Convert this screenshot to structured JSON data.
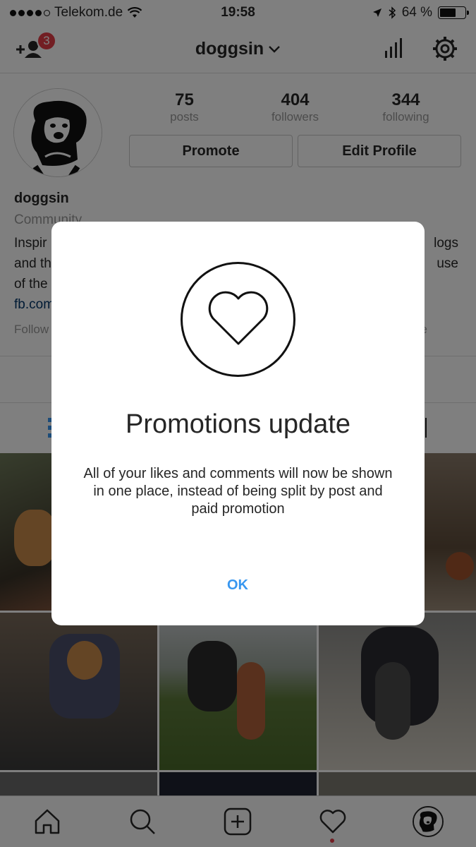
{
  "status_bar": {
    "carrier": "Telekom.de",
    "time": "19:58",
    "battery": "64 %",
    "battery_level": 0.64
  },
  "nav": {
    "username": "doggsin",
    "notification_count": "3"
  },
  "profile": {
    "stats": [
      {
        "value": "75",
        "label": "posts"
      },
      {
        "value": "404",
        "label": "followers"
      },
      {
        "value": "344",
        "label": "following"
      }
    ],
    "promote_label": "Promote",
    "edit_label": "Edit Profile",
    "name": "doggsin",
    "category": "Community",
    "bio_line1": "Inspir",
    "bio_line1_end": "logs",
    "bio_line2": "and th",
    "bio_line2_end": "use",
    "bio_line3": "of the",
    "link": "fb.com",
    "followed_by": "Follow",
    "followed_by_end": "e"
  },
  "modal": {
    "icon": "heart-icon",
    "title": "Promotions update",
    "body": "All of your likes and comments will now be shown in one place, instead of being split by post and paid promotion",
    "ok_label": "OK"
  },
  "tabbar": {
    "items": [
      "home-icon",
      "search-icon",
      "add-post-icon",
      "activity-heart-icon",
      "profile-avatar"
    ]
  },
  "colors": {
    "accent_blue": "#3897f0",
    "badge_red": "#e43c46",
    "link_navy": "#003569"
  }
}
